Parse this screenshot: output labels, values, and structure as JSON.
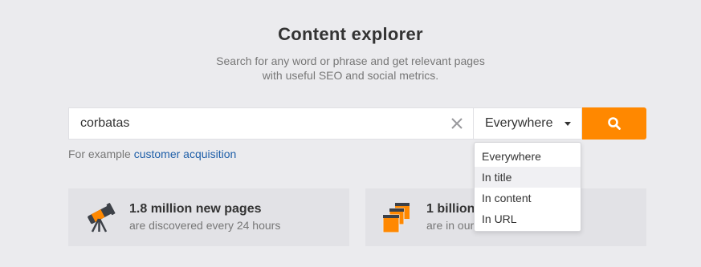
{
  "header": {
    "title": "Content explorer",
    "subtitle_line1": "Search for any word or phrase and get relevant pages",
    "subtitle_line2": "with useful SEO and social metrics."
  },
  "search": {
    "value": "corbatas",
    "clear_icon": "close-icon",
    "scope_selected": "Everywhere",
    "button_icon": "search-icon"
  },
  "example": {
    "prefix": "For example",
    "link": "customer acquisition"
  },
  "dropdown": {
    "options": [
      "Everywhere",
      "In title",
      "In content",
      "In URL"
    ],
    "hovered": "In title"
  },
  "cards": [
    {
      "icon": "telescope-icon",
      "title": "1.8 million new pages",
      "subtitle": "are discovered every 24 hours"
    },
    {
      "icon": "pages-stack-icon",
      "title": "1 billion",
      "subtitle": "are in our"
    }
  ],
  "colors": {
    "accent": "#ff8800",
    "link": "#1f5fa8",
    "background": "#ebebee"
  }
}
